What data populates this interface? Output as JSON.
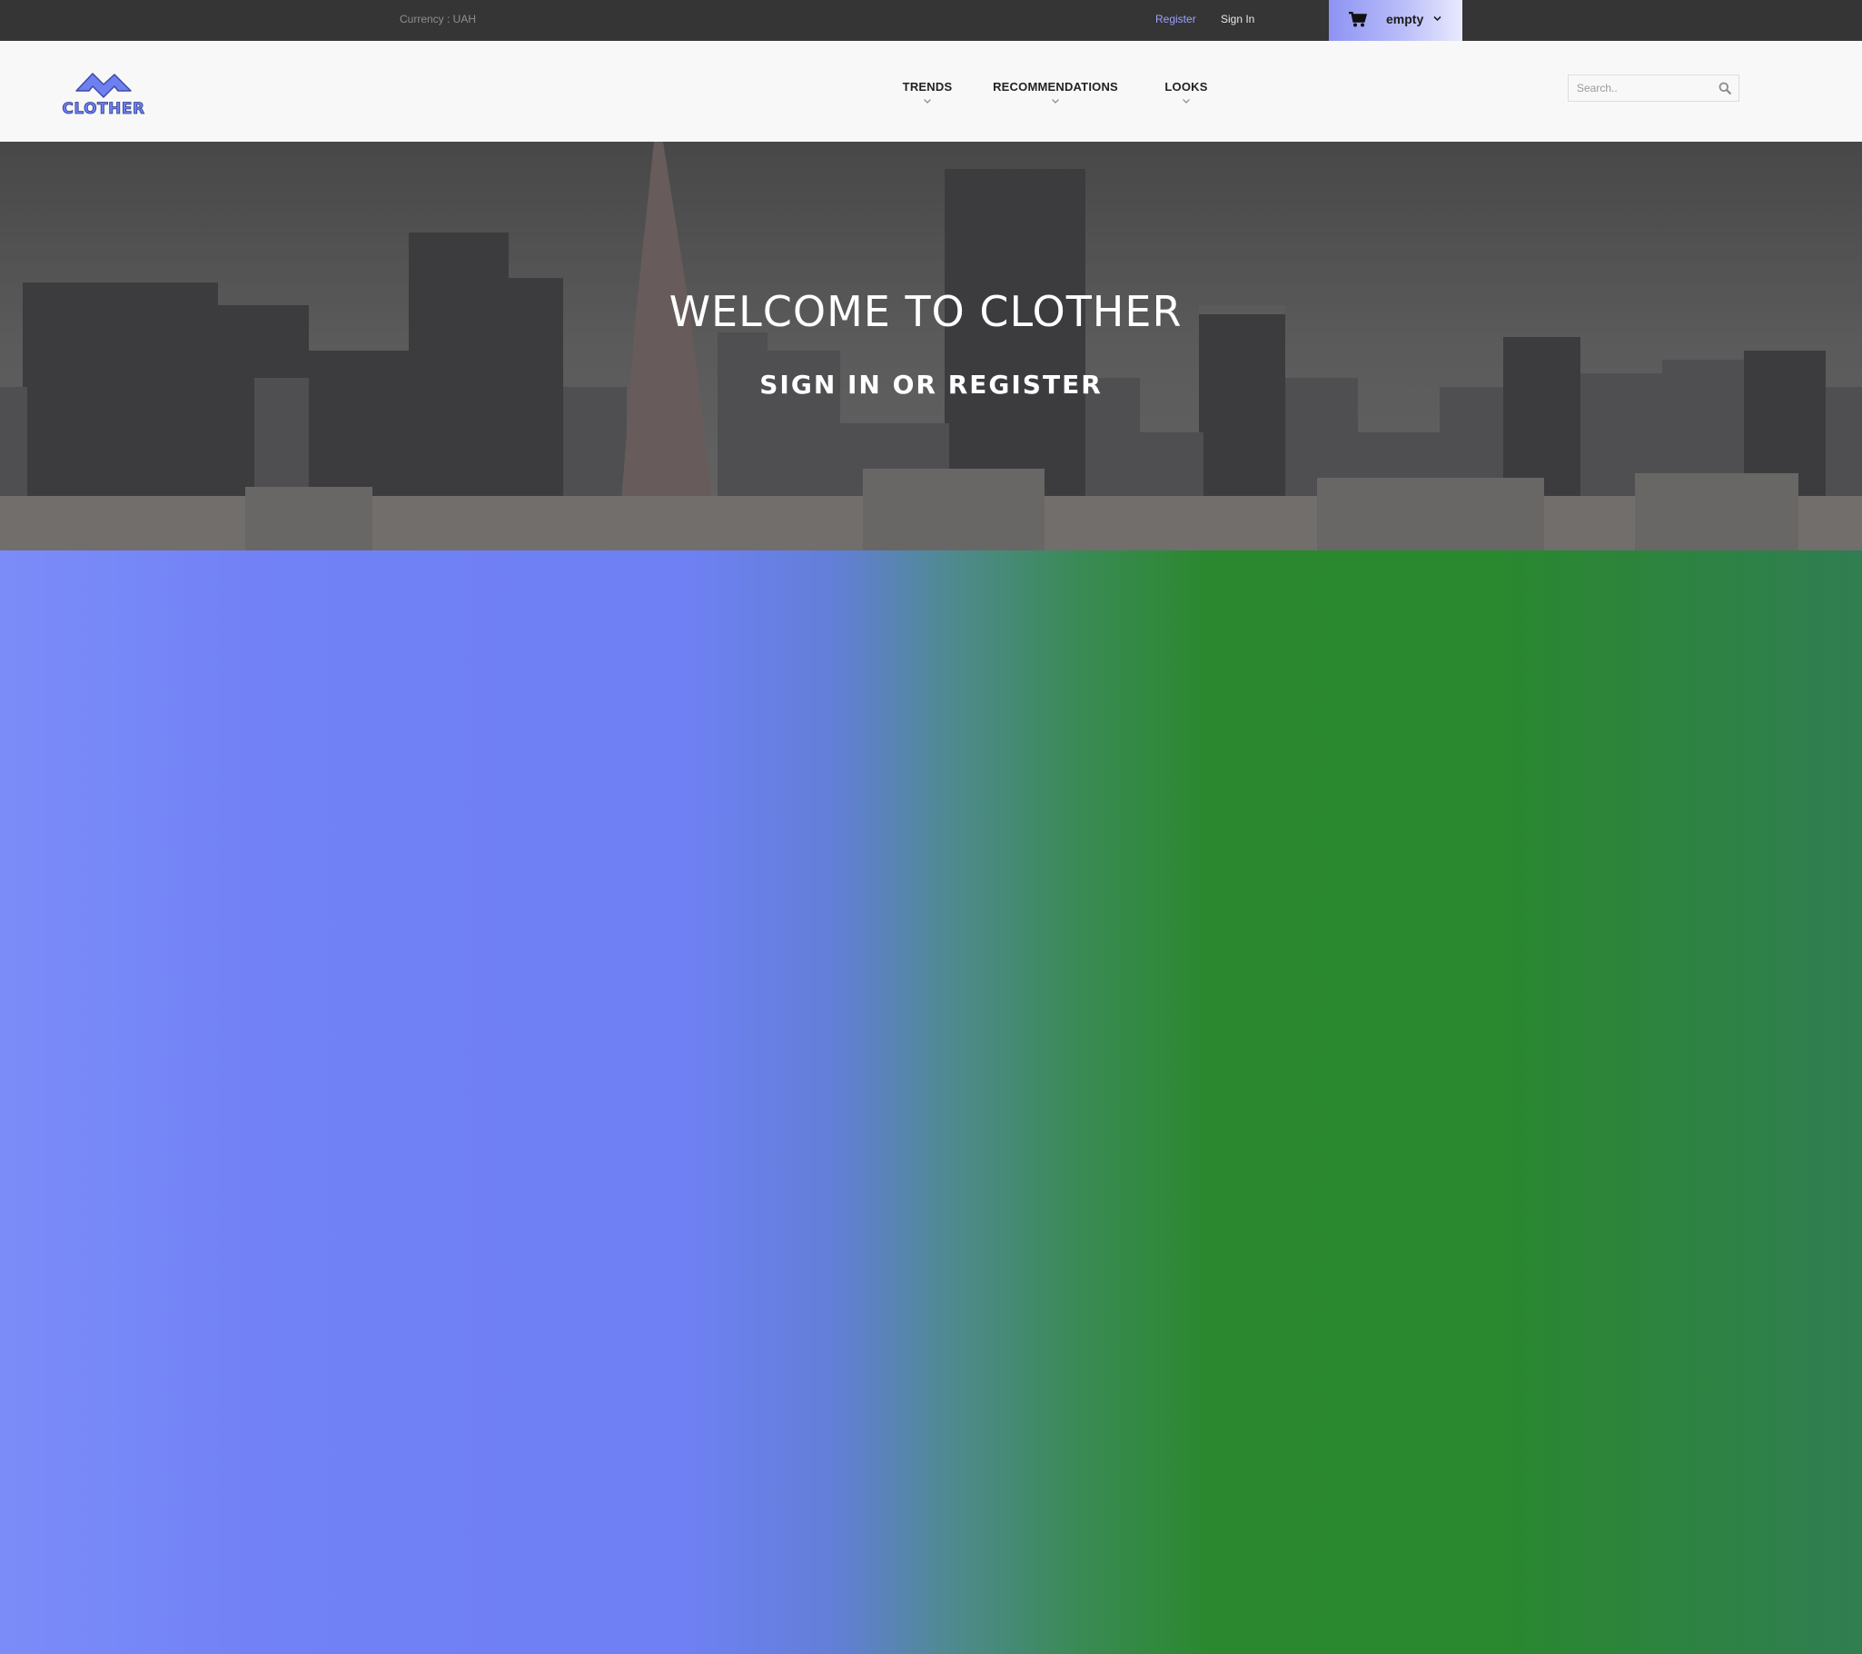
{
  "topbar": {
    "currency": "Currency : UAH",
    "register": "Register",
    "signin": "Sign In",
    "cart_label": "empty"
  },
  "header": {
    "logo_text": "CLOTHER",
    "nav": [
      {
        "label": "TRENDS"
      },
      {
        "label": "RECOMMENDATIONS"
      },
      {
        "label": "LOOKS"
      }
    ],
    "search_placeholder": "Search.."
  },
  "hero": {
    "title": "WELCOME TO CLOTHER",
    "subtitle": "SIGN IN OR REGISTER"
  },
  "colors": {
    "topbar_bg": "#353535",
    "accent": "#9aa2ff",
    "header_bg": "#f8f8f8",
    "gradient_left": "#7181f6",
    "gradient_right": "#2a882e"
  }
}
